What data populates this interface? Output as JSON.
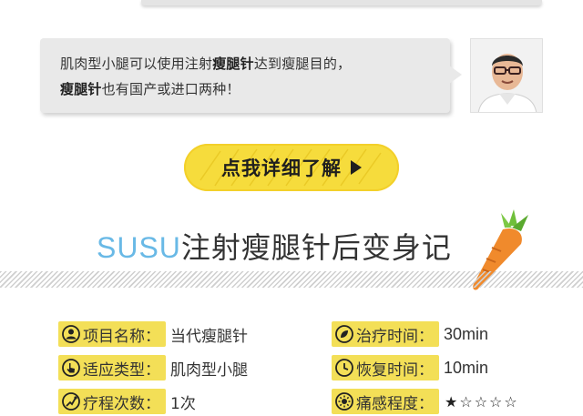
{
  "quote": {
    "line1_start": "肌肉型小腿可以使用注射",
    "line1_bold": "瘦腿针",
    "line1_end": "达到瘦腿目的，",
    "line2_bold1": "瘦腿针",
    "line2_mid": "也有国产或进口两种！"
  },
  "cta": {
    "label": "点我详细了解"
  },
  "section": {
    "brand": "SUSU",
    "title": "注射瘦腿针后变身记"
  },
  "info": {
    "project": {
      "label": "项目名称：",
      "value": "当代瘦腿针"
    },
    "type": {
      "label": "适应类型：",
      "value": "肌肉型小腿"
    },
    "course": {
      "label": "疗程次数：",
      "value": "1次"
    },
    "treat_time": {
      "label": "治疗时间：",
      "value": "30min"
    },
    "recovery": {
      "label": "恢复时间：",
      "value": "10min"
    },
    "pain": {
      "label": "痛感程度：",
      "value": "★☆☆☆☆",
      "rating": 1,
      "max": 5
    }
  },
  "colors": {
    "label_bg": "#f3df57",
    "brand": "#69b9e6",
    "cta": "#f6dc3c",
    "carrot": "#f08a2c",
    "leaf": "#6fbf3a"
  },
  "icons": [
    "user-icon",
    "pointer-icon",
    "course-icon",
    "clock-leaf-icon",
    "clock-icon",
    "sun-icon"
  ]
}
